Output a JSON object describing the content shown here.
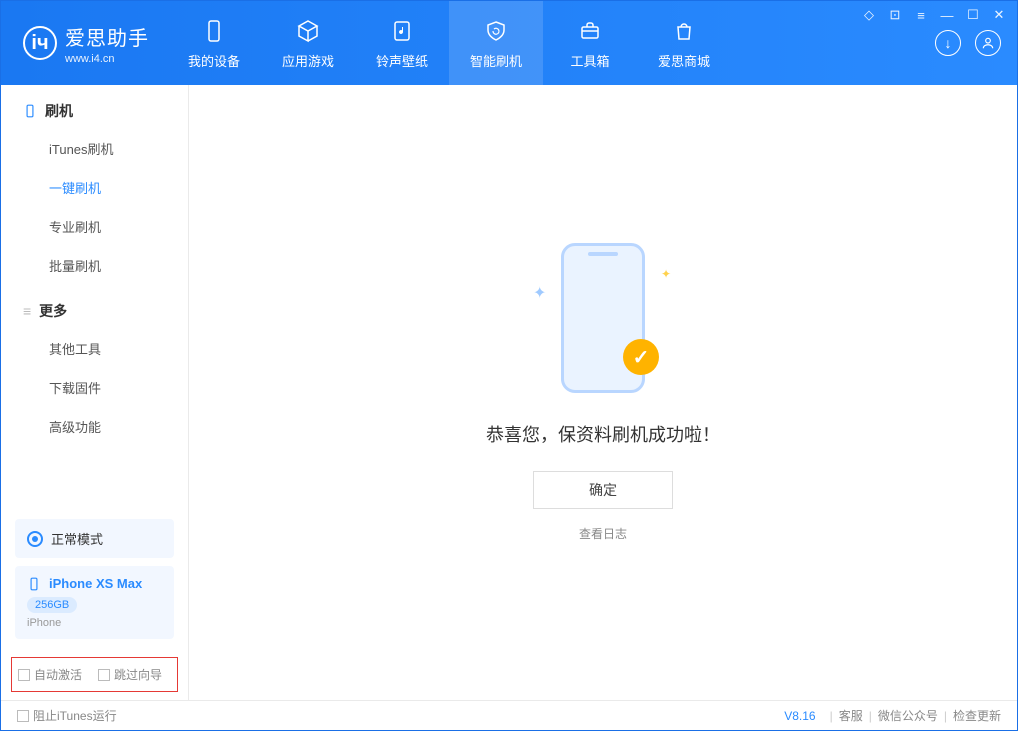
{
  "app": {
    "name": "爱思助手",
    "site": "www.i4.cn"
  },
  "nav": {
    "tabs": [
      {
        "label": "我的设备"
      },
      {
        "label": "应用游戏"
      },
      {
        "label": "铃声壁纸"
      },
      {
        "label": "智能刷机"
      },
      {
        "label": "工具箱"
      },
      {
        "label": "爱思商城"
      }
    ]
  },
  "sidebar": {
    "group_flash": "刷机",
    "flash_items": [
      {
        "label": "iTunes刷机"
      },
      {
        "label": "一键刷机"
      },
      {
        "label": "专业刷机"
      },
      {
        "label": "批量刷机"
      }
    ],
    "group_more": "更多",
    "more_items": [
      {
        "label": "其他工具"
      },
      {
        "label": "下载固件"
      },
      {
        "label": "高级功能"
      }
    ],
    "mode_label": "正常模式",
    "device": {
      "name": "iPhone XS Max",
      "capacity": "256GB",
      "type": "iPhone"
    },
    "checks": {
      "auto_activate": "自动激活",
      "skip_guide": "跳过向导"
    }
  },
  "main": {
    "success_text": "恭喜您，保资料刷机成功啦！",
    "ok_button": "确定",
    "view_log": "查看日志"
  },
  "footer": {
    "block_itunes": "阻止iTunes运行",
    "version": "V8.16",
    "links": {
      "support": "客服",
      "wechat": "微信公众号",
      "update": "检查更新"
    }
  }
}
